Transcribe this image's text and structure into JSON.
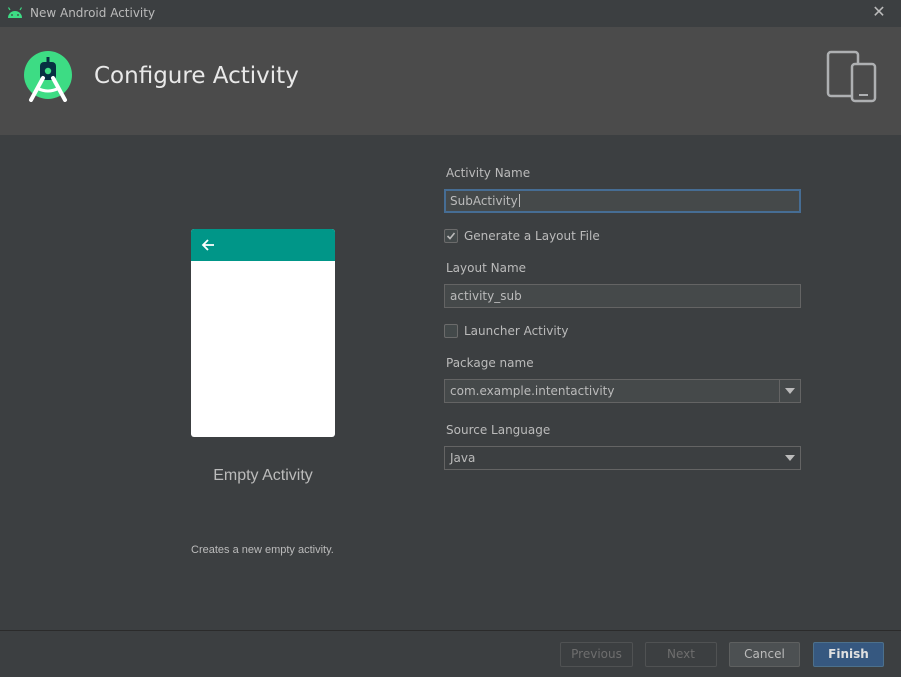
{
  "window": {
    "title": "New Android Activity",
    "close_symbol": "✕"
  },
  "header": {
    "title": "Configure Activity"
  },
  "preview": {
    "template_name": "Empty Activity",
    "description": "Creates a new empty activity.",
    "appbar_color": "#009688"
  },
  "form": {
    "activity_name_label": "Activity Name",
    "activity_name_value": "SubActivity",
    "generate_layout_label": "Generate a Layout File",
    "generate_layout_checked": true,
    "layout_name_label": "Layout Name",
    "layout_name_value": "activity_sub",
    "launcher_activity_label": "Launcher Activity",
    "launcher_activity_checked": false,
    "package_name_label": "Package name",
    "package_name_value": "com.example.intentactivity",
    "source_language_label": "Source Language",
    "source_language_value": "Java"
  },
  "buttons": {
    "previous": "Previous",
    "next": "Next",
    "cancel": "Cancel",
    "finish": "Finish"
  },
  "colors": {
    "background": "#3c3f41",
    "header_background": "#4b4b4b",
    "accent_green": "#3ddc84",
    "primary_button": "#365880"
  }
}
